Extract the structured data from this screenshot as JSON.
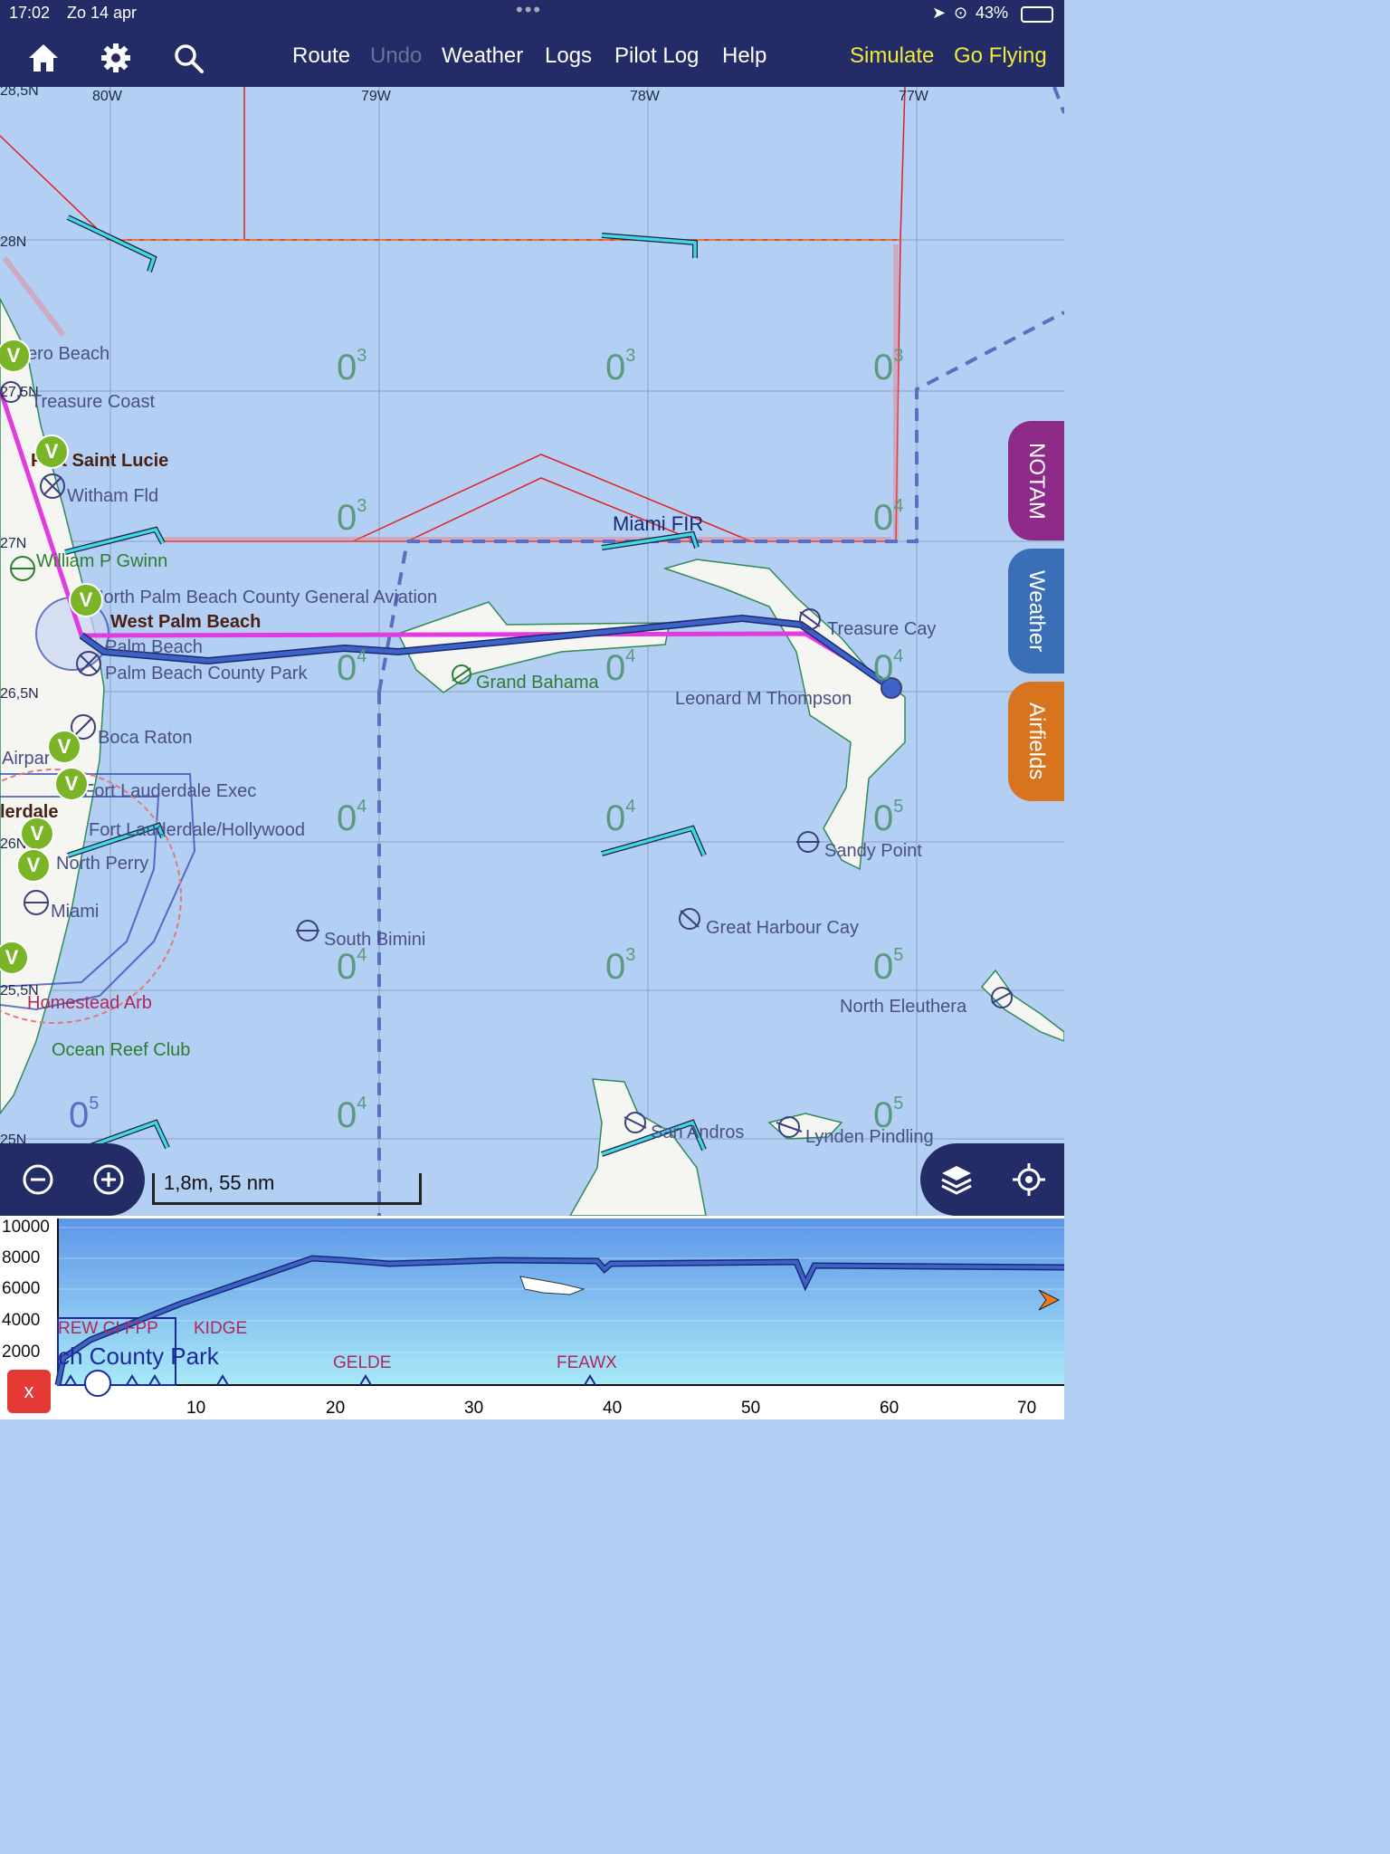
{
  "status_bar": {
    "time": "17:02",
    "date": "Zo 14 apr",
    "battery": "43%"
  },
  "toolbar": {
    "icons": [
      "home-icon",
      "gear-icon",
      "search-icon"
    ],
    "route": "Route",
    "undo": "Undo",
    "weather": "Weather",
    "logs": "Logs",
    "pilot_log": "Pilot Log",
    "help": "Help",
    "simulate": "Simulate",
    "go_flying": "Go Flying"
  },
  "map": {
    "longitudes": [
      "80W",
      "79W",
      "78W",
      "77W"
    ],
    "latitudes": [
      "28,5N",
      "28N",
      "27,5N",
      "27N",
      "26,5N",
      "26N",
      "25,5N",
      "25N"
    ],
    "fir_label": "Miami FIR",
    "airports": {
      "vero_beach": "ero Beach",
      "treasure_coast": "Treasure Coast",
      "port_saint_lucie": "Port Saint Lucie",
      "witham": "Witham Fld",
      "william_gwinn": "William P Gwinn",
      "north_palm": "North Palm Beach County General Aviation",
      "west_palm": "West Palm Beach",
      "palm_beach": "Palm Beach",
      "palm_beach_park": "Palm Beach County Park",
      "boca": "Boca Raton",
      "airpark": "Airpar",
      "ft_exec": "Fort Lauderdale Exec",
      "lauderdale": "lerdale",
      "ft_hollywood": "Fort Lauderdale/Hollywood",
      "north_perry": "North Perry",
      "miami": "Miami",
      "homestead": "Homestead Arb",
      "ocean_reef": "Ocean Reef Club",
      "grand_bahama": "Grand Bahama",
      "treasure_cay": "Treasure Cay",
      "leonard": "Leonard M Thompson",
      "sandy_point": "Sandy Point",
      "great_harbour": "Great Harbour Cay",
      "south_bimini": "South Bimini",
      "north_eleuthera": "North Eleuthera",
      "san_andros": "San Andros",
      "lynden": "Lynden Pindling"
    },
    "vfr_badge": "V",
    "scale": "1,8m, 55 nm"
  },
  "side_tabs": {
    "notam": "NOTAM",
    "notam_color": "#8e2a87",
    "weather": "Weather",
    "weather_color": "#3a6fb8",
    "airfields": "Airfields",
    "airfields_color": "#d8731e"
  },
  "controls": {
    "zoom_out": "zoom-out",
    "zoom_in": "zoom-in",
    "layers": "layers-icon",
    "locate": "locate-icon"
  },
  "profile": {
    "y_labels": [
      "10000",
      "8000",
      "6000",
      "4000",
      "2000"
    ],
    "x_labels": [
      "10",
      "20",
      "30",
      "40",
      "50",
      "60",
      "70"
    ],
    "waypoints": [
      "REW CI FPP",
      "KIDGE",
      "GELDE",
      "FEAWX"
    ],
    "departure": "ch County Park",
    "close": "x"
  },
  "colors": {
    "route": "#e23be0",
    "track": "#3d63c9",
    "toolbar": "#232c66",
    "water": "#b3cff3",
    "land": "#f5f6f2"
  }
}
